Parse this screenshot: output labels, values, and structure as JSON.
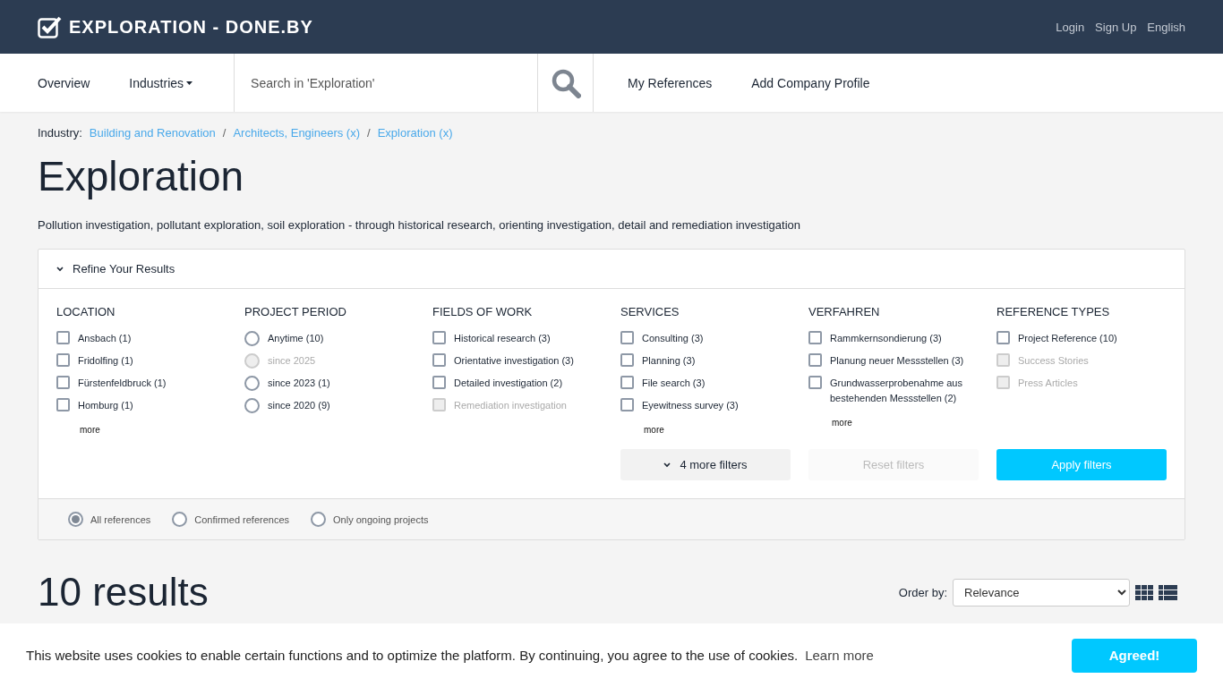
{
  "header": {
    "logo": "EXPLORATION - DONE.BY",
    "links": [
      "Login",
      "Sign Up",
      "English"
    ]
  },
  "nav": {
    "items": [
      {
        "label": "Overview",
        "dropdown": false
      },
      {
        "label": "Industries",
        "dropdown": true
      }
    ],
    "search": {
      "placeholder": "Search in 'Exploration'"
    },
    "links": [
      "My References",
      "Add Company Profile"
    ]
  },
  "breadcrumb": {
    "label": "Industry:",
    "separator": "/",
    "items": [
      "Building and Renovation",
      "Architects, Engineers (x)",
      "Exploration (x)"
    ]
  },
  "title": "Exploration",
  "description": "Pollution investigation, pollutant exploration, soil exploration - through historical research, orienting investigation, detail and remediation investigation",
  "filters": {
    "heading": "Refine Your Results",
    "expanded": true,
    "groups": [
      {
        "title": "LOCATION",
        "kind": "checkbox",
        "more": "more",
        "options": [
          {
            "label": "Ansbach (1)",
            "checked": false,
            "disabled": false
          },
          {
            "label": "Fridolfing (1)",
            "checked": false,
            "disabled": false
          },
          {
            "label": "Fürstenfeldbruck (1)",
            "checked": false,
            "disabled": false
          },
          {
            "label": "Homburg (1)",
            "checked": false,
            "disabled": false
          }
        ]
      },
      {
        "title": "PROJECT PERIOD",
        "kind": "radio",
        "options": [
          {
            "label": "Anytime (10)",
            "selected": false,
            "disabled": false
          },
          {
            "label": "since 2025",
            "selected": false,
            "disabled": true
          },
          {
            "label": "since 2023 (1)",
            "selected": false,
            "disabled": false
          },
          {
            "label": "since 2020 (9)",
            "selected": false,
            "disabled": false
          }
        ]
      },
      {
        "title": "FIELDS OF WORK",
        "kind": "checkbox",
        "options": [
          {
            "label": "Historical research (3)",
            "checked": false,
            "disabled": false
          },
          {
            "label": "Orientative investigation (3)",
            "checked": false,
            "disabled": false
          },
          {
            "label": "Detailed investigation (2)",
            "checked": false,
            "disabled": false
          },
          {
            "label": "Remediation investigation",
            "checked": false,
            "disabled": true
          }
        ]
      },
      {
        "title": "SERVICES",
        "kind": "checkbox",
        "more": "more",
        "options": [
          {
            "label": "Consulting (3)",
            "checked": false,
            "disabled": false
          },
          {
            "label": "Planning (3)",
            "checked": false,
            "disabled": false
          },
          {
            "label": "File search (3)",
            "checked": false,
            "disabled": false
          },
          {
            "label": "Eyewitness survey (3)",
            "checked": false,
            "disabled": false
          }
        ]
      },
      {
        "title": "VERFAHREN",
        "kind": "checkbox",
        "more": "more",
        "options": [
          {
            "label": "Rammkernsondierung (3)",
            "checked": false,
            "disabled": false
          },
          {
            "label": "Planung neuer Messstellen (3)",
            "checked": false,
            "disabled": false
          },
          {
            "label": "Grundwasserprobenahme aus bestehenden Messstellen (2)",
            "checked": false,
            "disabled": false
          }
        ]
      },
      {
        "title": "REFERENCE TYPES",
        "kind": "checkbox",
        "options": [
          {
            "label": "Project Reference (10)",
            "checked": false,
            "disabled": false
          },
          {
            "label": "Success Stories",
            "checked": false,
            "disabled": true
          },
          {
            "label": "Press Articles",
            "checked": false,
            "disabled": true
          }
        ]
      }
    ],
    "more_filters": "4 more filters",
    "reset": {
      "label": "Reset filters",
      "disabled": true
    },
    "apply": "Apply filters",
    "scope": [
      {
        "label": "All references",
        "selected": true
      },
      {
        "label": "Confirmed references",
        "selected": false
      },
      {
        "label": "Only ongoing projects",
        "selected": false
      }
    ]
  },
  "results": {
    "count": "10 results",
    "order_label": "Order by:",
    "order_value": "Relevance",
    "views": [
      {
        "kind": "grid",
        "selected": false
      },
      {
        "kind": "list",
        "selected": false
      }
    ]
  },
  "cookie": {
    "text": "This website uses cookies to enable certain functions and to optimize the platform. By continuing, you agree to the use of cookies.",
    "link": "Learn more",
    "button": "Agreed!"
  }
}
